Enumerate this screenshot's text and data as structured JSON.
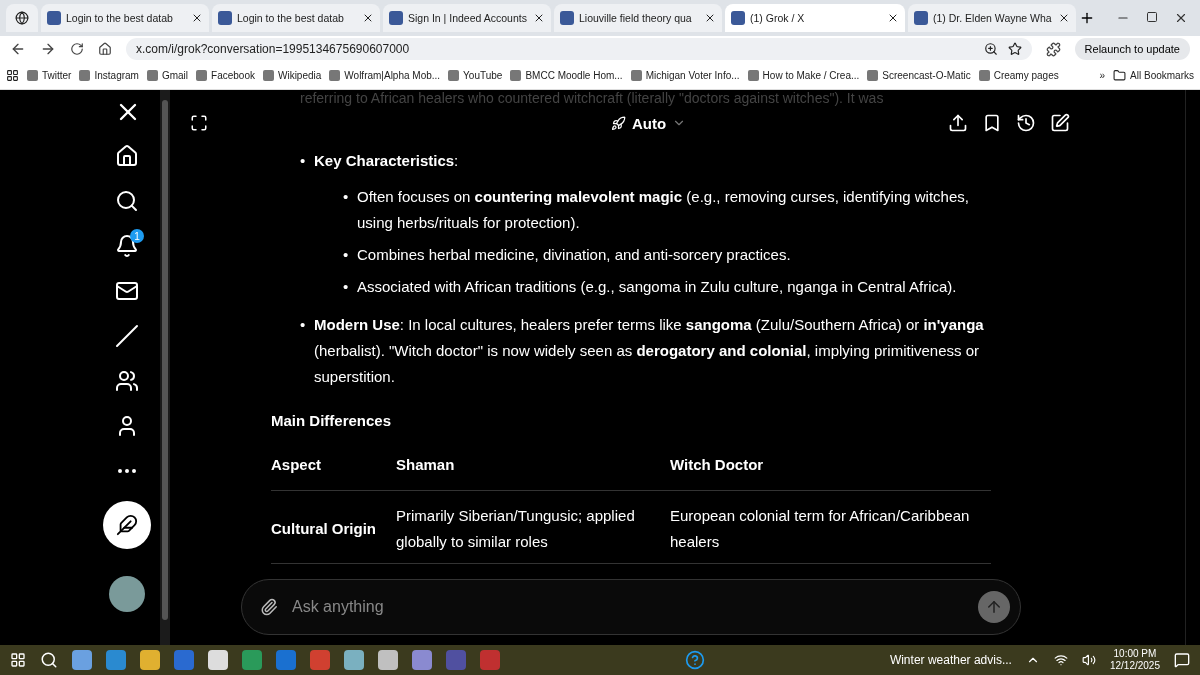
{
  "browser": {
    "tabs": [
      {
        "kind": "icon",
        "selected": false
      },
      {
        "kind": "tab",
        "title": "Login to the best datab",
        "selected": false
      },
      {
        "kind": "tab",
        "title": "Login to the best datab",
        "selected": false
      },
      {
        "kind": "tab",
        "title": "Sign In | Indeed Accounts",
        "selected": false
      },
      {
        "kind": "tab",
        "title": "Liouville field theory qua",
        "selected": false
      },
      {
        "kind": "tab",
        "title": "(1) Grok / X",
        "selected": true
      },
      {
        "kind": "tab",
        "title": "(1) Dr. Elden Wayne Wha",
        "selected": false
      }
    ],
    "url": "x.com/i/grok?conversation=1995134675690607000",
    "relaunch": "Relaunch to update",
    "bookmarks": [
      "Twitter",
      "Instagram",
      "Gmail",
      "Facebook",
      "Wikipedia",
      "Wolfram|Alpha Mob...",
      "YouTube",
      "BMCC Moodle Hom...",
      "Michigan Voter Info...",
      "How to Make / Crea...",
      "Screencast-O-Matic",
      "Creamy pages"
    ],
    "more": "»",
    "all_bookmarks": "All Bookmarks"
  },
  "sidebar": {
    "notification_count": "1"
  },
  "chat": {
    "mode": "Auto",
    "faded_text": "referring to African healers who countered witchcraft (literally \"doctors against witches\"). It was",
    "bullets": [
      {
        "marker": "•",
        "text": "**Key Characteristics**:",
        "children": [
          {
            "marker": "•",
            "text": "Often focuses on **countering malevolent magic** (e.g., removing curses, identifying witches, using herbs/rituals for protection)."
          },
          {
            "marker": "•",
            "text": "Combines herbal medicine, divination, and anti-sorcery practices."
          },
          {
            "marker": "•",
            "text": "Associated with African traditions (e.g., sangoma in Zulu culture, nganga in Central Africa)."
          }
        ]
      },
      {
        "marker": "•",
        "text": "**Modern Use**: In local cultures, healers prefer terms like **sangoma** (Zulu/Southern Africa) or **in'yanga** (herbalist). \"Witch doctor\" is now widely seen as **derogatory and colonial**, implying primitiveness or superstition."
      }
    ],
    "table_title": "Main Differences",
    "table": {
      "columns": [
        "Aspect",
        "Shaman",
        "Witch Doctor"
      ],
      "rows": [
        [
          "Cultural Origin",
          "Primarily Siberian/Tungusic; applied globally to similar roles",
          "European colonial term for African/Caribbean healers"
        ]
      ]
    },
    "input": {
      "placeholder": "Ask anything"
    }
  },
  "taskbar": {
    "weather": "Winter weather advis...",
    "time": "10:00 PM",
    "date": "12/12/2025"
  }
}
